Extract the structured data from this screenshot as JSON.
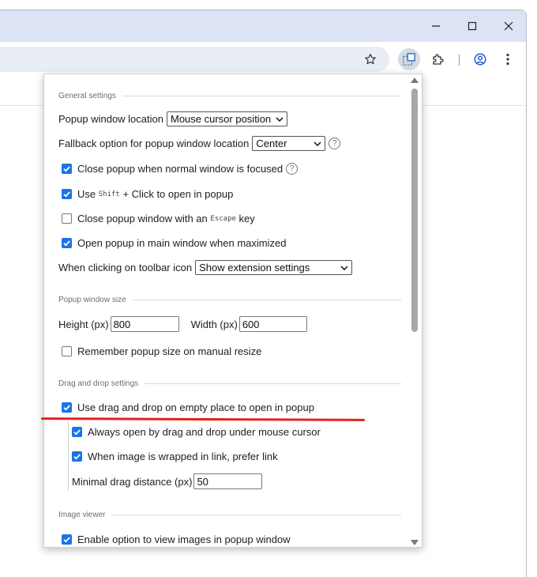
{
  "window": {
    "controls": [
      "minimize",
      "maximize",
      "close"
    ]
  },
  "toolbar": {
    "icons": [
      "star-icon",
      "extension-popup-icon",
      "puzzle-icon",
      "profile-icon",
      "menu-icon"
    ]
  },
  "colors": {
    "accent": "#1a73e8",
    "highlight": "#e8201e",
    "titlebar": "#dbe3f4"
  },
  "popup": {
    "general": {
      "heading": "General settings",
      "location_label": "Popup window location",
      "location_value": "Mouse cursor position",
      "fallback_label": "Fallback option for popup window location",
      "fallback_value": "Center",
      "close_on_focus": "Close popup when normal window is focused",
      "shift_pre": "Use",
      "shift_key": "Shift",
      "shift_post": "+ Click to open in popup",
      "escape_pre": "Close popup window with an",
      "escape_key": "Escape",
      "escape_post": "key",
      "open_main": "Open popup in main window when maximized",
      "toolbar_label": "When clicking on toolbar icon",
      "toolbar_value": "Show extension settings",
      "help_glyph": "?"
    },
    "size": {
      "heading": "Popup window size",
      "height_label": "Height (px)",
      "height_value": "800",
      "width_label": "Width (px)",
      "width_value": "600",
      "remember": "Remember popup size on manual resize"
    },
    "dnd": {
      "heading": "Drag and drop settings",
      "use_dnd": "Use drag and drop on empty place to open in popup",
      "always_cursor": "Always open by drag and drop under mouse cursor",
      "prefer_link": "When image is wrapped in link, prefer link",
      "min_distance_label": "Minimal drag distance (px)",
      "min_distance_value": "50"
    },
    "viewer": {
      "heading": "Image viewer",
      "enable": "Enable option to view images in popup window"
    }
  }
}
